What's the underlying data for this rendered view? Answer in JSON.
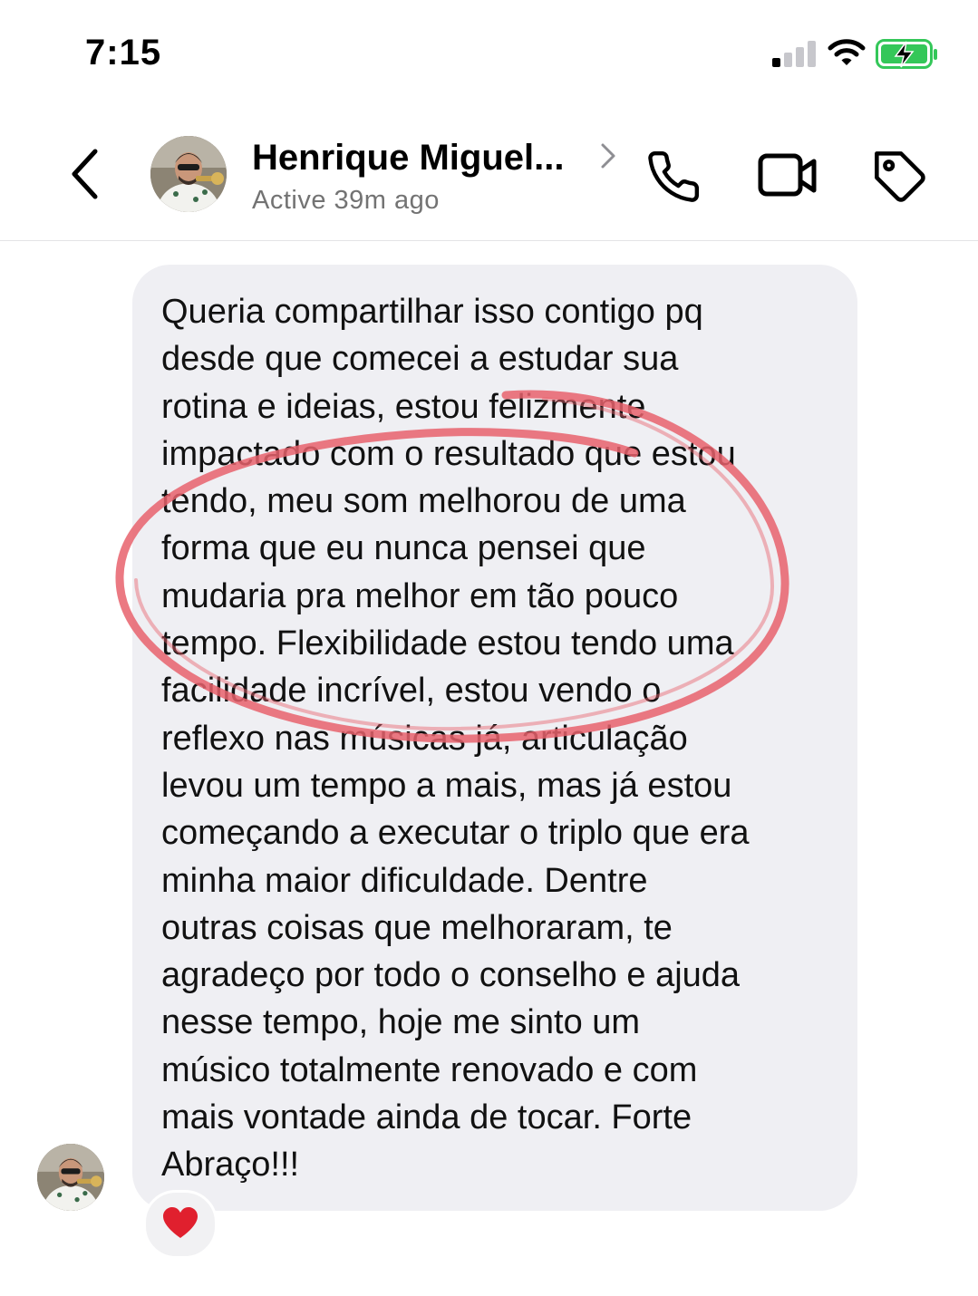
{
  "status_bar": {
    "time": "7:15",
    "signal_bars_active": 1,
    "battery_state": "charging"
  },
  "header": {
    "contact_name": "Henrique Miguel...",
    "status": "Active 39m ago",
    "icons": [
      "back-arrow",
      "chevron-right",
      "phone",
      "video-camera",
      "tag"
    ]
  },
  "message": {
    "lines": [
      "Queria compartilhar isso contigo pq",
      "desde que comecei a estudar sua",
      "rotina e ideias, estou felizmente",
      "impactado com o resultado que estou",
      "tendo, meu som melhorou de uma",
      "forma que eu nunca pensei que",
      "mudaria pra melhor em tão pouco",
      "tempo. Flexibilidade estou tendo uma",
      "facilidade incrível, estou vendo o",
      "reflexo nas músicas já, articulação",
      "levou um tempo a mais, mas já estou",
      "começando a executar o triplo que era",
      "minha maior dificuldade. Dentre",
      "outras coisas que melhoraram, te",
      "agradeço por todo o conselho e ajuda",
      "nesse tempo, hoje me sinto um",
      "músico totalmente renovado e com",
      "mais vontade ainda de tocar. Forte",
      "Abraço!!!"
    ],
    "reaction": "heart"
  },
  "colors": {
    "bubble": "#efeff3",
    "secondary_text": "#737373",
    "highlight_circle": "#e8626c",
    "battery_green": "#34c759",
    "heart_red": "#e0202e"
  }
}
